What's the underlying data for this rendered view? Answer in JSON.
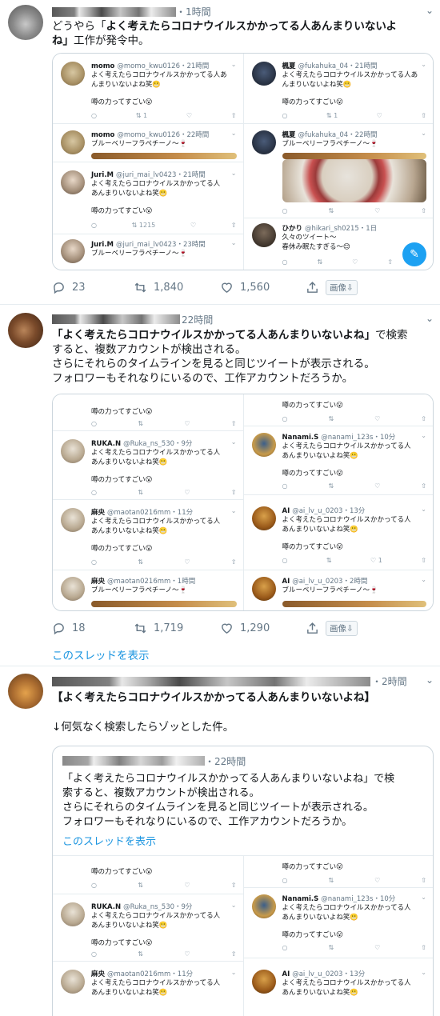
{
  "tweet1": {
    "time": "・1時間",
    "lines": [
      "どうやら「よく考えたらコロナウイルスかかってる人あんまりいないよ",
      "ね」工作が発令中。"
    ],
    "line1_plain": "どうやら「",
    "line1_bold": "よく考えたらコロナウイルスかかってる人あんまりいないよ",
    "line2_bold": "ね」",
    "line2_plain": "工作が発令中。",
    "replies": "23",
    "retweets": "1,840",
    "likes": "1,560",
    "image_badge": "画像⇩"
  },
  "tweet2": {
    "time": "22時間",
    "line1_bold": "「よく考えたらコロナウイルスかかってる人あんまりいないよね」",
    "line1_plain": "で検索",
    "line2": "すると、複数アカウントが検出される。",
    "line3": "さらにそれらのタイムラインを見ると同じツイートが表示される。",
    "line4": "フォロワーもそれなりにいるので、工作アカウントだろうか。",
    "replies": "18",
    "retweets": "1,719",
    "likes": "1,290",
    "image_badge": "画像⇩",
    "thread_link": "このスレッドを表示"
  },
  "tweet3": {
    "time": "・2時間",
    "line1": "【よく考えたらコロナウイルスかかってる人あんまりいないよね】",
    "line2": "↓何気なく検索したらゾッとした件。",
    "quote": {
      "time": "・22時間",
      "line1": "「よく考えたらコロナウイルスかかってる人あんまりいないよね」で検",
      "line2": "索すると、複数アカウントが検出される。",
      "line3": "さらにそれらのタイムラインを見ると同じツイートが表示される。",
      "line4": "フォロワーもそれなりにいるので、工作アカウントだろうか。",
      "thread_link": "このスレッドを表示"
    }
  },
  "mini": {
    "text_a1": "よく考えたらコロナウイルスかかってる人あ",
    "text_a2": "んまりいないよね笑😬",
    "text_b1": "よく考えたらコロナウイルスかかってる人",
    "text_b2": "あんまりいないよね笑😬",
    "buzz": "噂の力ってすごい😮",
    "berry": "ブルーベリーフラペチーノ〜🍷",
    "momo": "momo",
    "momo_h1": "@momo_kwu0126・21時間",
    "momo_h2": "@momo_kwu0126・22時間",
    "juri": "Juri.M",
    "juri_h1": "@juri_mai_lv0423・21時間",
    "juri_h2": "@juri_mai_lv0423・23時間",
    "kaede": "楓夏",
    "kaede_h1": "@fukahuka_04・21時間",
    "kaede_h2": "@fukahuka_04・22時間",
    "hikari": "ひかり",
    "hikari_h": "@hikari_sh0215・1日",
    "hikari_l1": "久々のツイート〜",
    "hikari_l2": "春休み眠たすぎる〜😊",
    "ruka": "RUKA.N",
    "ruka_h": "@Ruka_ns_530・9分",
    "mao": "麻央",
    "mao_h1": "@maotan0216mm・11分",
    "mao_h2": "@maotan0216mm・1時間",
    "nanami": "Nanami.S",
    "nanami_h": "@nanami_123s・10分",
    "ai": "AI",
    "ai_h1": "@ai_lv_u_0203・13分",
    "ai_h2": "@ai_lv_u_0203・2時間",
    "rt1": "1",
    "rt215": "1215",
    "like1": "1"
  },
  "colors": {
    "accent": "#1da1f2",
    "link": "#1b95e0",
    "muted": "#657786",
    "border": "#e6ecf0"
  }
}
